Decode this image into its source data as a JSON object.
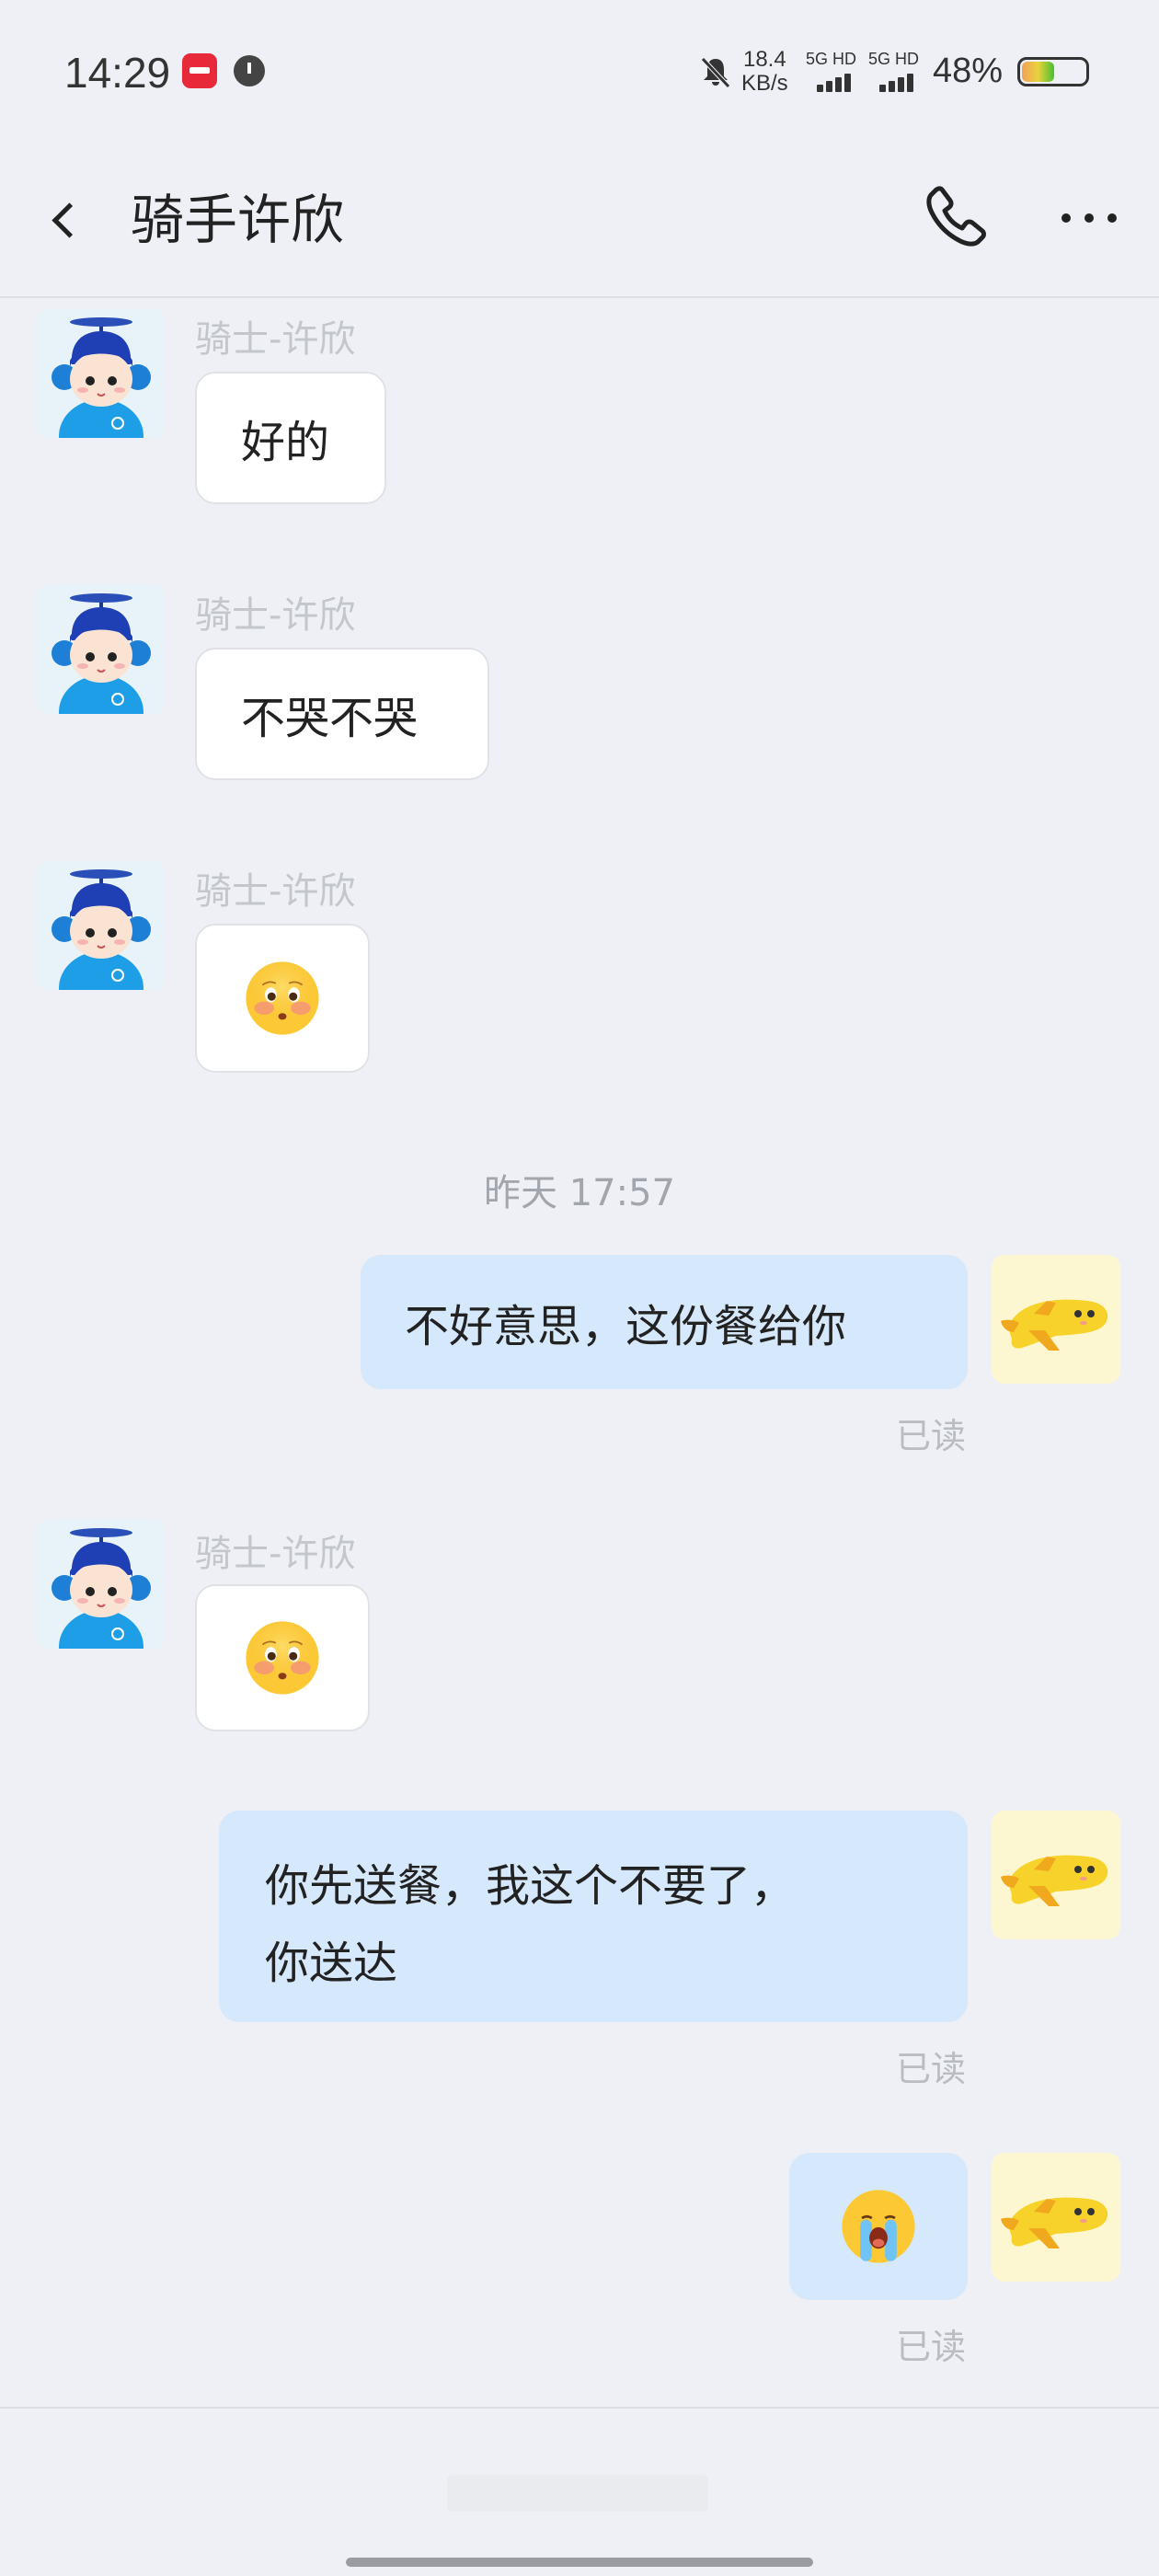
{
  "status_bar": {
    "time": "14:29",
    "net_speed_value": "18.4",
    "net_speed_unit": "KB/s",
    "network_1": "5G HD",
    "network_2": "5G HD",
    "battery_percent": "48%",
    "battery_level": 0.48
  },
  "header": {
    "title": "骑手许欣",
    "back_icon": "chevron-left-icon",
    "call_icon": "phone-icon",
    "more_icon": "more-horizontal-icon"
  },
  "messages": [
    {
      "from": "rider",
      "sender": "骑士-许欣",
      "text": "好的"
    },
    {
      "from": "rider",
      "sender": "骑士-许欣",
      "text": "不哭不哭"
    },
    {
      "from": "rider",
      "sender": "骑士-许欣",
      "emoji": "blushing-face-emoji"
    },
    {
      "from": "me",
      "text": "不好意思，这份餐给你",
      "status": "已读"
    },
    {
      "from": "rider",
      "sender": "骑士-许欣",
      "emoji": "blushing-face-emoji"
    },
    {
      "from": "me",
      "text_line1": "你先送餐，我这个不要了，",
      "text_line2": "你送达",
      "status": "已读"
    },
    {
      "from": "me",
      "emoji": "crying-face-emoji",
      "status": "已读"
    }
  ],
  "timestamp": "昨天 17:57",
  "colors": {
    "background": "#eef0f5",
    "outgoing_bubble": "#d6e8fb",
    "incoming_bubble": "#ffffff"
  }
}
